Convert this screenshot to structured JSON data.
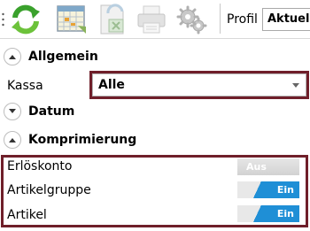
{
  "toolbar": {
    "icons": [
      "refresh-icon",
      "calendar-grid-icon",
      "excel-export-icon",
      "printer-icon",
      "settings-gears-icon"
    ],
    "profil_label": "Profil",
    "profil_value": "Aktuelle"
  },
  "sections": {
    "allgemein": {
      "title": "Allgemein",
      "kassa_label": "Kassa",
      "kassa_value": "Alle"
    },
    "datum": {
      "title": "Datum"
    },
    "komprimierung": {
      "title": "Komprimierung",
      "rows": [
        {
          "label": "Erlöskonto",
          "state": "Aus"
        },
        {
          "label": "Artikelgruppe",
          "state": "Ein"
        },
        {
          "label": "Artikel",
          "state": "Ein"
        }
      ]
    }
  },
  "colors": {
    "highlight_border": "#6f1f2a",
    "toggle_on": "#1f8fd6",
    "toggle_off": "#d9d9d9"
  }
}
